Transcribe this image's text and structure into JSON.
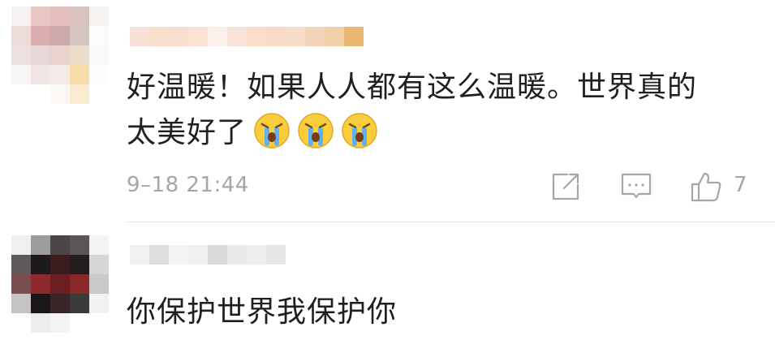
{
  "comments": [
    {
      "text_line1": "好温暖！如果人人都有这么温暖。世界真的",
      "text_line2": "太美好了",
      "emojis": [
        "crying-face-emoji",
        "crying-face-emoji",
        "crying-face-emoji"
      ],
      "timestamp": "9–18 21:44",
      "like_count": "7",
      "icons": [
        "share-icon",
        "reply-icon",
        "like-icon"
      ]
    },
    {
      "text": "你保护世界我保护你"
    }
  ],
  "colors": {
    "text": "#1f1f1f",
    "meta": "#a6a6a6",
    "divider": "#e4e4e4",
    "emoji_face": "#f9cd3c",
    "emoji_tears": "#5fb0ef"
  }
}
